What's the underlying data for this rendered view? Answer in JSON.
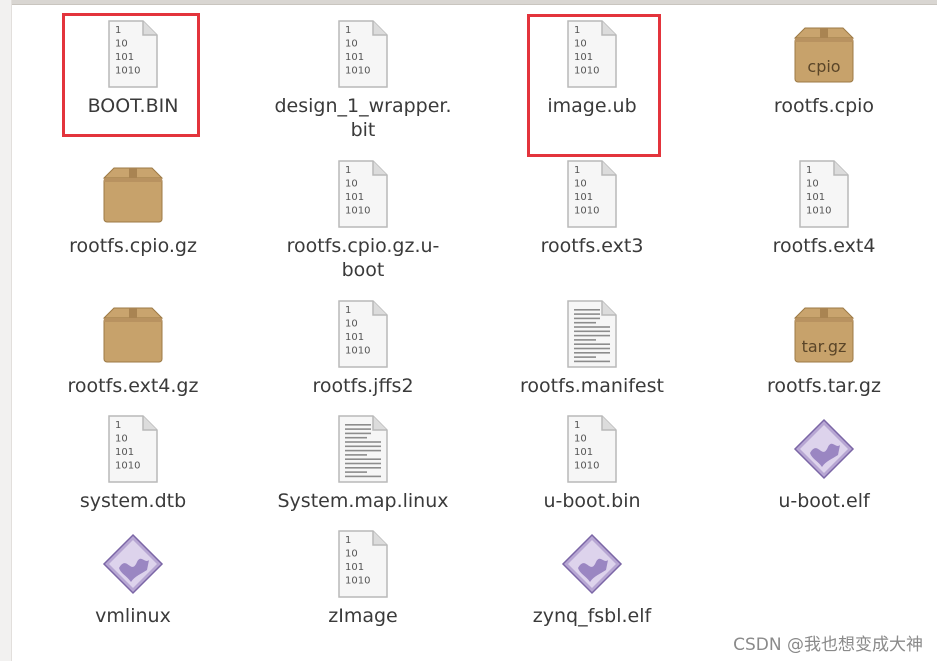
{
  "files": [
    {
      "name": "BOOT.BIN",
      "type": "binary"
    },
    {
      "name": "design_1_wrapper.\nbit",
      "type": "binary"
    },
    {
      "name": "image.ub",
      "type": "binary"
    },
    {
      "name": "rootfs.cpio",
      "type": "archive",
      "badge": "cpio"
    },
    {
      "name": "rootfs.cpio.gz",
      "type": "archive",
      "badge": ""
    },
    {
      "name": "rootfs.cpio.gz.u-\nboot",
      "type": "binary"
    },
    {
      "name": "rootfs.ext3",
      "type": "binary"
    },
    {
      "name": "rootfs.ext4",
      "type": "binary"
    },
    {
      "name": "rootfs.ext4.gz",
      "type": "archive",
      "badge": ""
    },
    {
      "name": "rootfs.jffs2",
      "type": "binary"
    },
    {
      "name": "rootfs.manifest",
      "type": "text"
    },
    {
      "name": "rootfs.tar.gz",
      "type": "archive",
      "badge": "tar.gz"
    },
    {
      "name": "system.dtb",
      "type": "binary"
    },
    {
      "name": "System.map.linux",
      "type": "text"
    },
    {
      "name": "u-boot.bin",
      "type": "binary"
    },
    {
      "name": "u-boot.elf",
      "type": "executable"
    },
    {
      "name": "vmlinux",
      "type": "executable"
    },
    {
      "name": "zImage",
      "type": "binary"
    },
    {
      "name": "zynq_fsbl.elf",
      "type": "executable"
    }
  ],
  "binary_glyph_lines": [
    "1",
    "10",
    "101",
    "1010"
  ],
  "highlight_color": "#e3343c",
  "watermark": "CSDN @我也想变成大神"
}
